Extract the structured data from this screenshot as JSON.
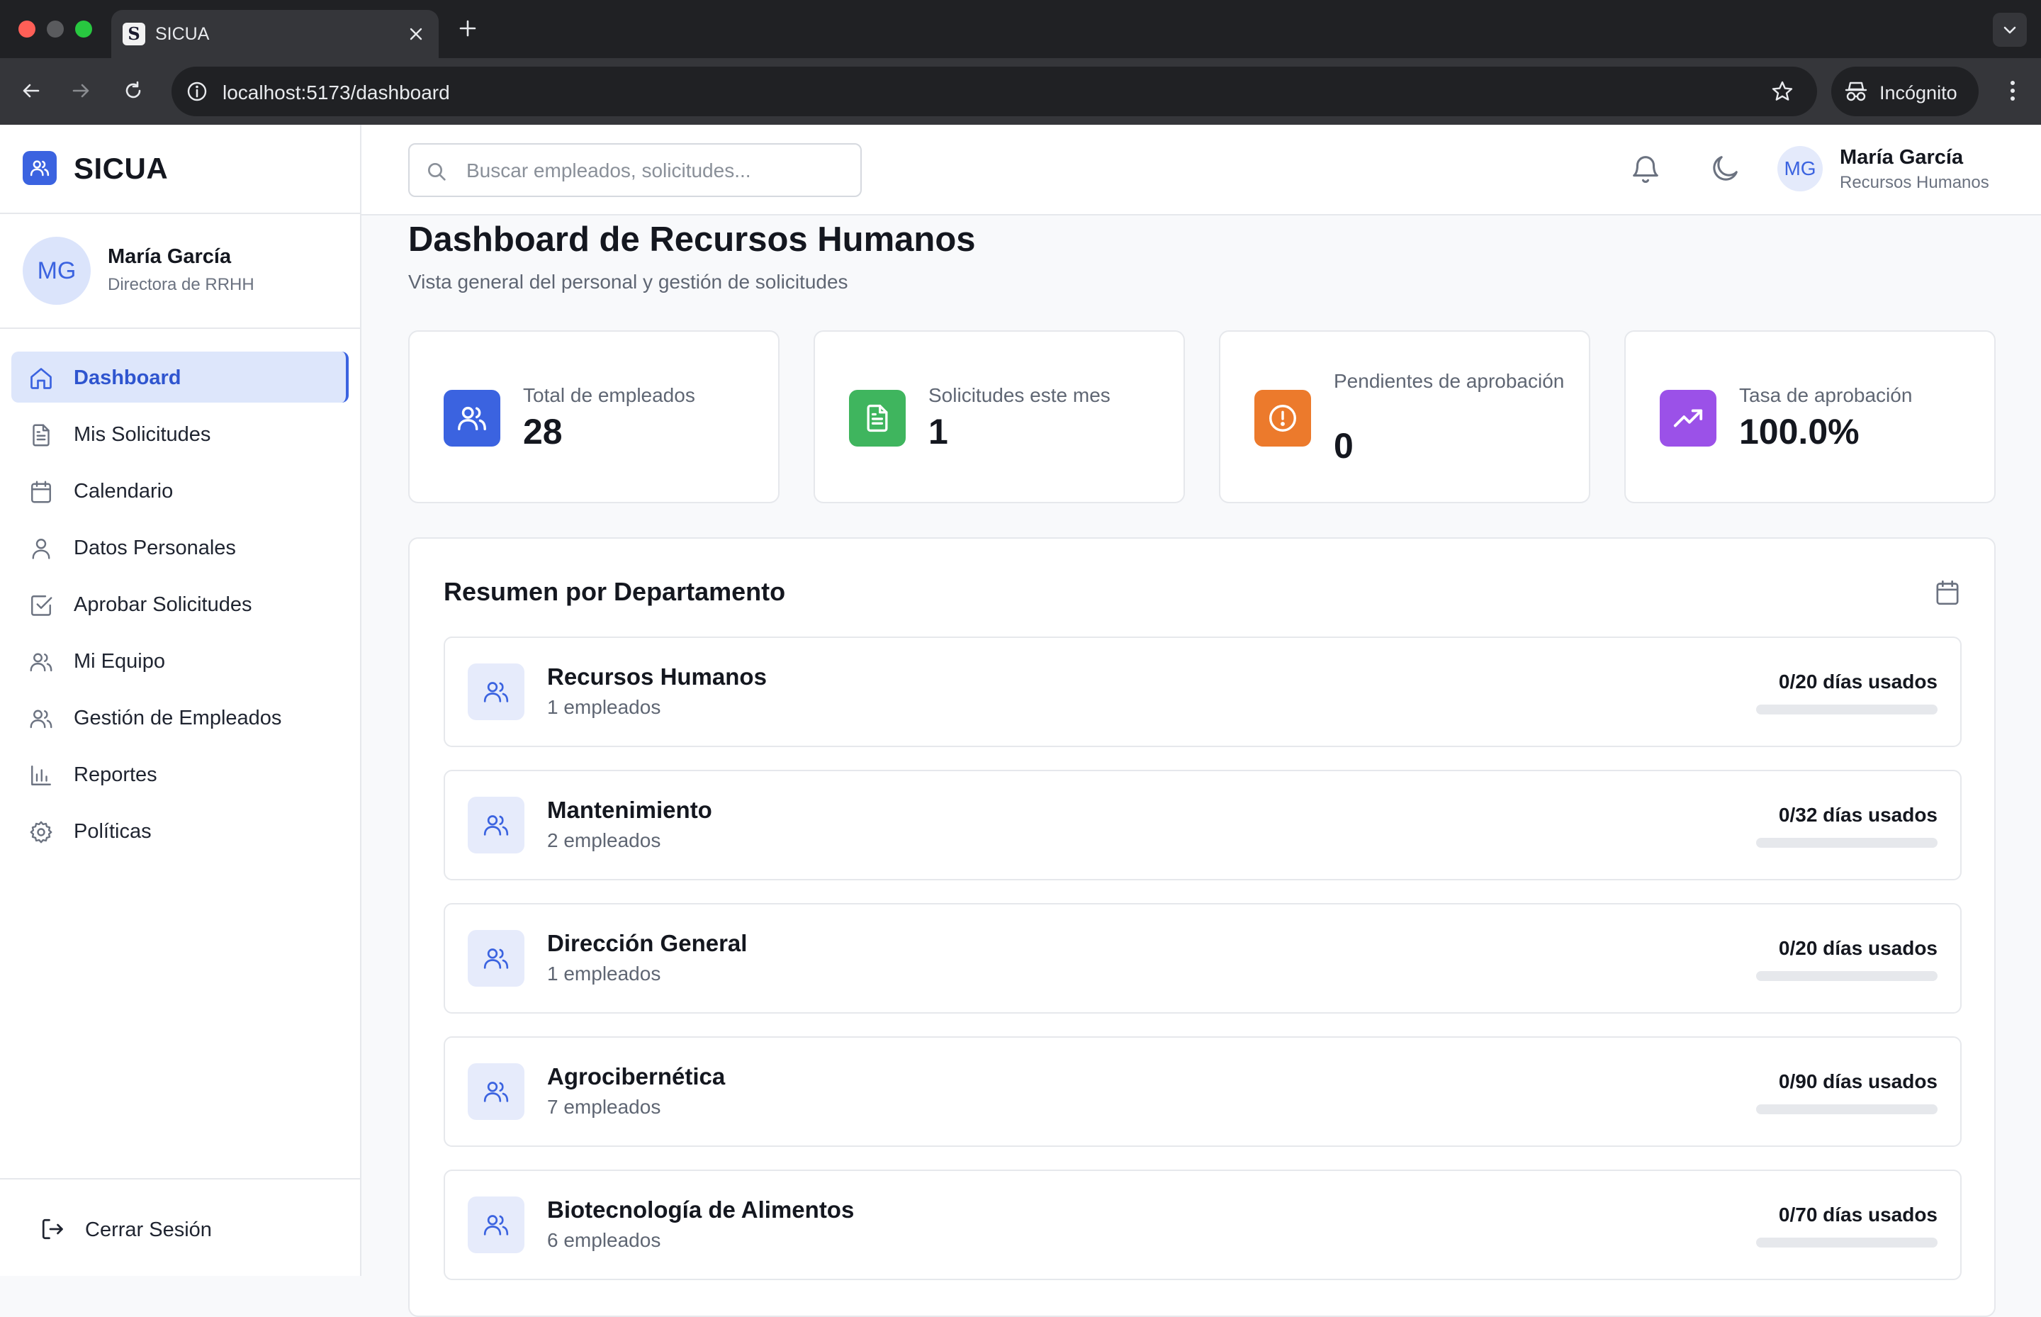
{
  "browser": {
    "tab_title": "SICUA",
    "favicon_letter": "S",
    "url": "localhost:5173/dashboard",
    "incognito_label": "Incógnito"
  },
  "sidebar": {
    "brand": "SICUA",
    "profile": {
      "initials": "MG",
      "name": "María García",
      "role": "Directora de RRHH"
    },
    "items": [
      {
        "label": "Dashboard",
        "icon": "home-icon",
        "active": true
      },
      {
        "label": "Mis Solicitudes",
        "icon": "document-icon"
      },
      {
        "label": "Calendario",
        "icon": "calendar-icon"
      },
      {
        "label": "Datos Personales",
        "icon": "user-icon"
      },
      {
        "label": "Aprobar Solicitudes",
        "icon": "check-square-icon"
      },
      {
        "label": "Mi Equipo",
        "icon": "users-icon"
      },
      {
        "label": "Gestión de Empleados",
        "icon": "users-icon"
      },
      {
        "label": "Reportes",
        "icon": "bar-chart-icon"
      },
      {
        "label": "Políticas",
        "icon": "gear-icon"
      }
    ],
    "logout_label": "Cerrar Sesión"
  },
  "header": {
    "search_placeholder": "Buscar empleados, solicitudes...",
    "user": {
      "initials": "MG",
      "name": "María García",
      "department": "Recursos Humanos"
    }
  },
  "main": {
    "title": "Dashboard de Recursos Humanos",
    "subtitle": "Vista general del personal y gestión de solicitudes",
    "stats": [
      {
        "label": "Total de empleados",
        "value": "28",
        "icon": "users-icon",
        "color": "#3b63e0"
      },
      {
        "label": "Solicitudes este mes",
        "value": "1",
        "icon": "document-icon",
        "color": "#3fb55e"
      },
      {
        "label": "Pendientes de aprobación",
        "value": "0",
        "icon": "alert-circle-icon",
        "color": "#ec7a2c"
      },
      {
        "label": "Tasa de aprobación",
        "value": "100.0%",
        "icon": "trending-up-icon",
        "color": "#9b51e8"
      }
    ],
    "departments_title": "Resumen por Departamento",
    "departments": [
      {
        "name": "Recursos Humanos",
        "employees": "1 empleados",
        "usage": "0/20 días usados",
        "fraction": 0
      },
      {
        "name": "Mantenimiento",
        "employees": "2 empleados",
        "usage": "0/32 días usados",
        "fraction": 0
      },
      {
        "name": "Dirección General",
        "employees": "1 empleados",
        "usage": "0/20 días usados",
        "fraction": 0
      },
      {
        "name": "Agrocibernética",
        "employees": "7 empleados",
        "usage": "0/90 días usados",
        "fraction": 0
      },
      {
        "name": "Biotecnología de Alimentos",
        "employees": "6 empleados",
        "usage": "0/70 días usados",
        "fraction": 0
      }
    ]
  },
  "colors": {
    "accent": "#3b63e0",
    "active_bg": "#dde6fb",
    "chrome_dark": "#202124",
    "chrome_mid": "#35363a"
  }
}
